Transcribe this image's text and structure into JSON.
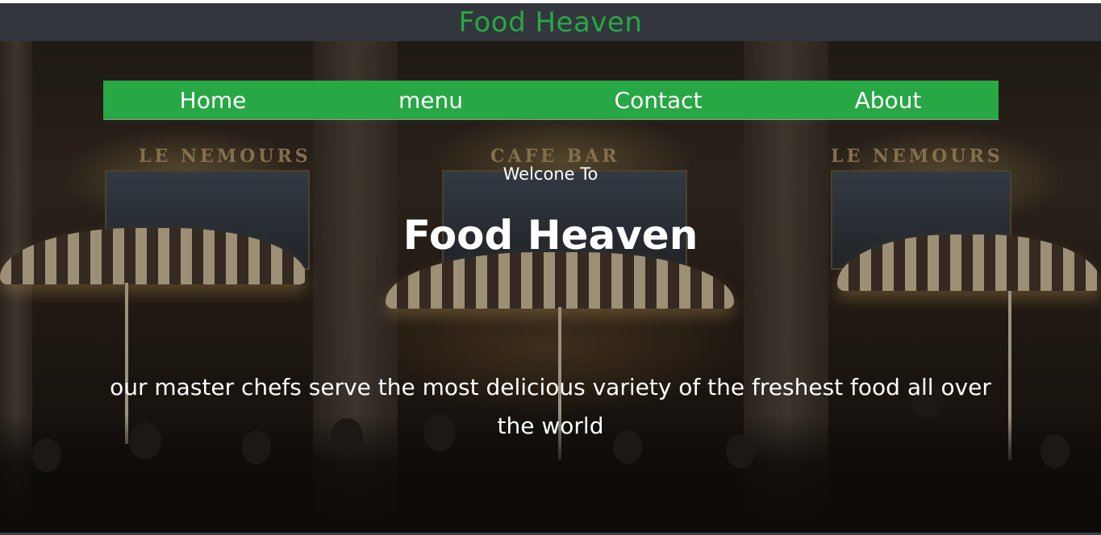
{
  "header": {
    "brand": "Food Heaven"
  },
  "nav": {
    "items": [
      {
        "label": "Home"
      },
      {
        "label": "menu"
      },
      {
        "label": "Contact"
      },
      {
        "label": "About"
      }
    ]
  },
  "hero": {
    "welcome": "Welcone To",
    "title": "Food Heaven",
    "tagline": "our master chefs serve the most delicious variety of the freshest food all over the world",
    "background": {
      "signs": [
        "LE NEMOURS",
        "CAFE BAR",
        "LE NEMOURS"
      ]
    }
  },
  "colors": {
    "brand_green": "#27a844",
    "nav_bg": "#28a745",
    "header_bg": "#33363d",
    "text": "#ffffff"
  }
}
